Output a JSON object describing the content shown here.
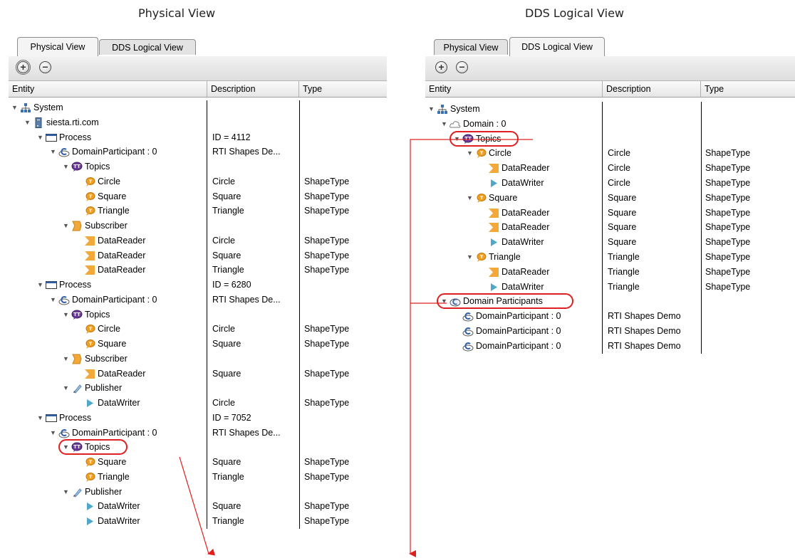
{
  "captions": {
    "left": "Physical View",
    "right": "DDS Logical View"
  },
  "tabs": [
    "Physical View",
    "DDS Logical View"
  ],
  "toolbar": {
    "expand_icon": "plus-circle-icon",
    "collapse_icon": "minus-circle-icon"
  },
  "columns": [
    "Entity",
    "Description",
    "Type"
  ],
  "colors": {
    "highlight": "#e02020",
    "reader_icon": "#f3a93a",
    "writer_icon": "#4fa8c9",
    "topic_icon": "#f0a020"
  },
  "physical_tree": [
    {
      "depth": 0,
      "exp": true,
      "icon": "system",
      "entity": "System",
      "desc": "",
      "type": ""
    },
    {
      "depth": 1,
      "exp": true,
      "icon": "host",
      "entity": "siesta.rti.com",
      "desc": "",
      "type": ""
    },
    {
      "depth": 2,
      "exp": true,
      "icon": "process",
      "entity": "Process",
      "desc": "ID = 4112",
      "type": ""
    },
    {
      "depth": 3,
      "exp": true,
      "icon": "participant",
      "entity": "DomainParticipant : 0",
      "desc": "RTI Shapes De...",
      "type": ""
    },
    {
      "depth": 4,
      "exp": true,
      "icon": "topics",
      "entity": "Topics",
      "desc": "",
      "type": ""
    },
    {
      "depth": 5,
      "exp": null,
      "icon": "topic",
      "entity": "Circle",
      "desc": "Circle",
      "type": "ShapeType"
    },
    {
      "depth": 5,
      "exp": null,
      "icon": "topic",
      "entity": "Square",
      "desc": "Square",
      "type": "ShapeType"
    },
    {
      "depth": 5,
      "exp": null,
      "icon": "topic",
      "entity": "Triangle",
      "desc": "Triangle",
      "type": "ShapeType"
    },
    {
      "depth": 4,
      "exp": true,
      "icon": "subscriber",
      "entity": "Subscriber",
      "desc": "",
      "type": ""
    },
    {
      "depth": 5,
      "exp": null,
      "icon": "reader",
      "entity": "DataReader",
      "desc": "Circle",
      "type": "ShapeType"
    },
    {
      "depth": 5,
      "exp": null,
      "icon": "reader",
      "entity": "DataReader",
      "desc": "Square",
      "type": "ShapeType"
    },
    {
      "depth": 5,
      "exp": null,
      "icon": "reader",
      "entity": "DataReader",
      "desc": "Triangle",
      "type": "ShapeType"
    },
    {
      "depth": 2,
      "exp": true,
      "icon": "process",
      "entity": "Process",
      "desc": "ID = 6280",
      "type": ""
    },
    {
      "depth": 3,
      "exp": true,
      "icon": "participant",
      "entity": "DomainParticipant : 0",
      "desc": "RTI Shapes De...",
      "type": ""
    },
    {
      "depth": 4,
      "exp": true,
      "icon": "topics",
      "entity": "Topics",
      "desc": "",
      "type": ""
    },
    {
      "depth": 5,
      "exp": null,
      "icon": "topic",
      "entity": "Circle",
      "desc": "Circle",
      "type": "ShapeType"
    },
    {
      "depth": 5,
      "exp": null,
      "icon": "topic",
      "entity": "Square",
      "desc": "Square",
      "type": "ShapeType"
    },
    {
      "depth": 4,
      "exp": true,
      "icon": "subscriber",
      "entity": "Subscriber",
      "desc": "",
      "type": ""
    },
    {
      "depth": 5,
      "exp": null,
      "icon": "reader",
      "entity": "DataReader",
      "desc": "Square",
      "type": "ShapeType"
    },
    {
      "depth": 4,
      "exp": true,
      "icon": "publisher",
      "entity": "Publisher",
      "desc": "",
      "type": ""
    },
    {
      "depth": 5,
      "exp": null,
      "icon": "writer",
      "entity": "DataWriter",
      "desc": "Circle",
      "type": "ShapeType"
    },
    {
      "depth": 2,
      "exp": true,
      "icon": "process",
      "entity": "Process",
      "desc": "ID = 7052",
      "type": ""
    },
    {
      "depth": 3,
      "exp": true,
      "icon": "participant",
      "entity": "DomainParticipant : 0",
      "desc": "RTI Shapes De...",
      "type": ""
    },
    {
      "depth": 4,
      "exp": true,
      "icon": "topics",
      "entity": "Topics",
      "desc": "",
      "type": "",
      "highlight": true
    },
    {
      "depth": 5,
      "exp": null,
      "icon": "topic",
      "entity": "Square",
      "desc": "Square",
      "type": "ShapeType"
    },
    {
      "depth": 5,
      "exp": null,
      "icon": "topic",
      "entity": "Triangle",
      "desc": "Triangle",
      "type": "ShapeType"
    },
    {
      "depth": 4,
      "exp": true,
      "icon": "publisher",
      "entity": "Publisher",
      "desc": "",
      "type": ""
    },
    {
      "depth": 5,
      "exp": null,
      "icon": "writer",
      "entity": "DataWriter",
      "desc": "Square",
      "type": "ShapeType"
    },
    {
      "depth": 5,
      "exp": null,
      "icon": "writer",
      "entity": "DataWriter",
      "desc": "Triangle",
      "type": "ShapeType"
    }
  ],
  "logical_tree": [
    {
      "depth": 0,
      "exp": true,
      "icon": "system",
      "entity": "System",
      "desc": "",
      "type": ""
    },
    {
      "depth": 1,
      "exp": true,
      "icon": "domain",
      "entity": "Domain : 0",
      "desc": "",
      "type": ""
    },
    {
      "depth": 2,
      "exp": true,
      "icon": "topics",
      "entity": "Topics",
      "desc": "",
      "type": "",
      "highlight": true
    },
    {
      "depth": 3,
      "exp": true,
      "icon": "topic",
      "entity": "Circle",
      "desc": "Circle",
      "type": "ShapeType"
    },
    {
      "depth": 4,
      "exp": null,
      "icon": "reader",
      "entity": "DataReader",
      "desc": "Circle",
      "type": "ShapeType"
    },
    {
      "depth": 4,
      "exp": null,
      "icon": "writer",
      "entity": "DataWriter",
      "desc": "Circle",
      "type": "ShapeType"
    },
    {
      "depth": 3,
      "exp": true,
      "icon": "topic",
      "entity": "Square",
      "desc": "Square",
      "type": "ShapeType"
    },
    {
      "depth": 4,
      "exp": null,
      "icon": "reader",
      "entity": "DataReader",
      "desc": "Square",
      "type": "ShapeType"
    },
    {
      "depth": 4,
      "exp": null,
      "icon": "reader",
      "entity": "DataReader",
      "desc": "Square",
      "type": "ShapeType"
    },
    {
      "depth": 4,
      "exp": null,
      "icon": "writer",
      "entity": "DataWriter",
      "desc": "Square",
      "type": "ShapeType"
    },
    {
      "depth": 3,
      "exp": true,
      "icon": "topic",
      "entity": "Triangle",
      "desc": "Triangle",
      "type": "ShapeType"
    },
    {
      "depth": 4,
      "exp": null,
      "icon": "reader",
      "entity": "DataReader",
      "desc": "Triangle",
      "type": "ShapeType"
    },
    {
      "depth": 4,
      "exp": null,
      "icon": "writer",
      "entity": "DataWriter",
      "desc": "Triangle",
      "type": "ShapeType"
    },
    {
      "depth": 1,
      "exp": true,
      "icon": "participants",
      "entity": "Domain Participants",
      "desc": "",
      "type": "",
      "highlight": true
    },
    {
      "depth": 2,
      "exp": null,
      "icon": "participant",
      "entity": "DomainParticipant : 0",
      "desc": "RTI Shapes Demo",
      "type": ""
    },
    {
      "depth": 2,
      "exp": null,
      "icon": "participant",
      "entity": "DomainParticipant : 0",
      "desc": "RTI Shapes Demo",
      "type": ""
    },
    {
      "depth": 2,
      "exp": null,
      "icon": "participant",
      "entity": "DomainParticipant : 0",
      "desc": "RTI Shapes Demo",
      "type": ""
    }
  ]
}
